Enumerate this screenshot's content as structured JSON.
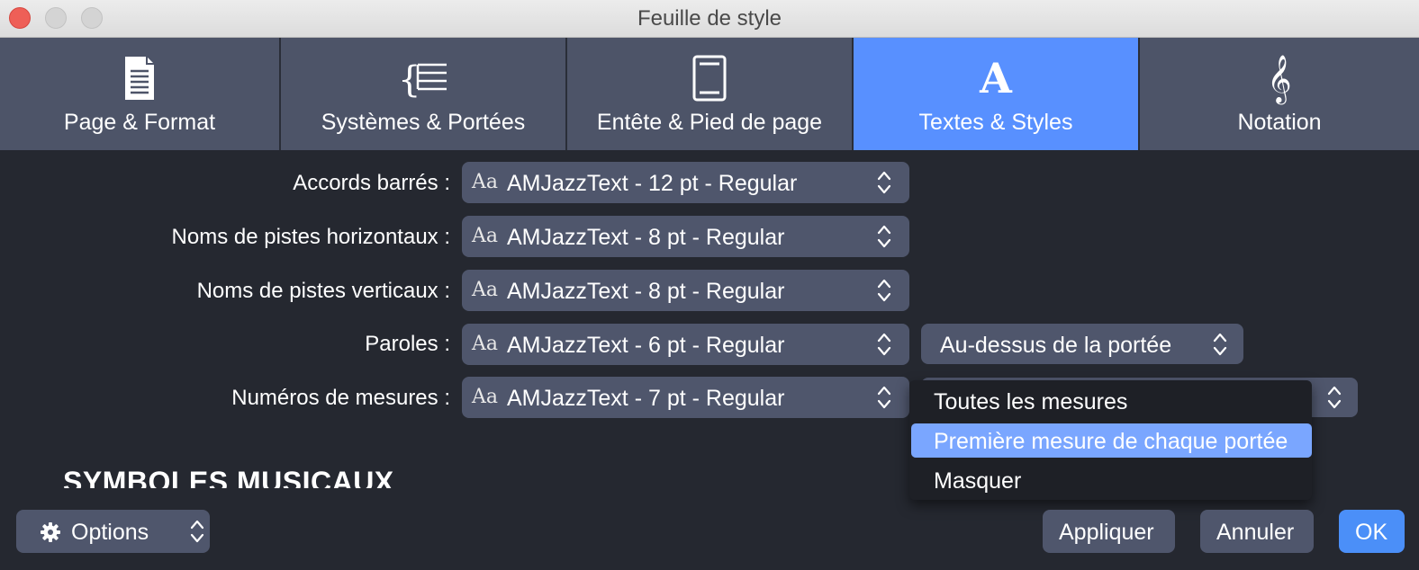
{
  "window": {
    "title": "Feuille de style"
  },
  "tabs": [
    {
      "label": "Page & Format",
      "icon": "page-icon"
    },
    {
      "label": "Systèmes & Portées",
      "icon": "staff-system-icon"
    },
    {
      "label": "Entête & Pied de page",
      "icon": "header-footer-icon"
    },
    {
      "label": "Textes & Styles",
      "icon": "text-a-icon",
      "active": true
    },
    {
      "label": "Notation",
      "icon": "treble-clef-icon"
    }
  ],
  "rows": [
    {
      "label": "Accords barrés :",
      "font_prefix": "Aa",
      "value": "AMJazzText - 12 pt - Regular"
    },
    {
      "label": "Noms de pistes horizontaux :",
      "font_prefix": "Aa",
      "value": "AMJazzText - 8 pt - Regular"
    },
    {
      "label": "Noms de pistes verticaux :",
      "font_prefix": "Aa",
      "value": "AMJazzText - 8 pt - Regular"
    },
    {
      "label": "Paroles :",
      "font_prefix": "Aa",
      "value": "AMJazzText - 6 pt - Regular"
    },
    {
      "label": "Numéros de mesures :",
      "font_prefix": "Aa",
      "value": "AMJazzText - 7 pt - Regular"
    }
  ],
  "lyrics_position": {
    "value": "Au-dessus de la portée"
  },
  "bar_numbers_menu": {
    "options": [
      "Toutes les mesures",
      "Première mesure de chaque portée",
      "Masquer"
    ],
    "highlighted": "Première mesure de chaque portée"
  },
  "section": {
    "title": "SYMBOLES MUSICAUX"
  },
  "footer": {
    "options_label": "Options",
    "apply_label": "Appliquer",
    "cancel_label": "Annuler",
    "ok_label": "OK"
  },
  "colors": {
    "accent": "#5890ff",
    "tab_bg": "#4d5468",
    "panel_bg": "#252830",
    "control_bg": "#4f566c",
    "menu_highlight": "#7aa6ff"
  }
}
